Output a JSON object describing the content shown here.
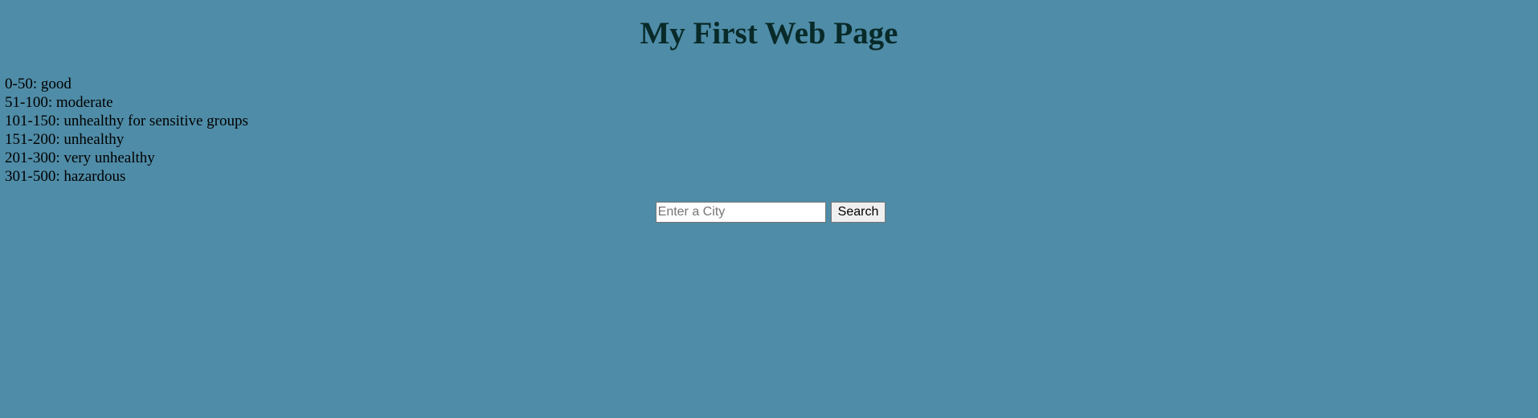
{
  "page": {
    "title": "My First Web Page",
    "background_color": "#4f8ca7",
    "title_color": "#082a28"
  },
  "aqi_scale": [
    {
      "label": "0-50: good"
    },
    {
      "label": "51-100: moderate"
    },
    {
      "label": "101-150: unhealthy for sensitive groups"
    },
    {
      "label": "151-200: unhealthy"
    },
    {
      "label": "201-300: very unhealthy"
    },
    {
      "label": "301-500: hazardous"
    }
  ],
  "search": {
    "placeholder": "Enter a City",
    "value": "",
    "button_label": "Search"
  }
}
